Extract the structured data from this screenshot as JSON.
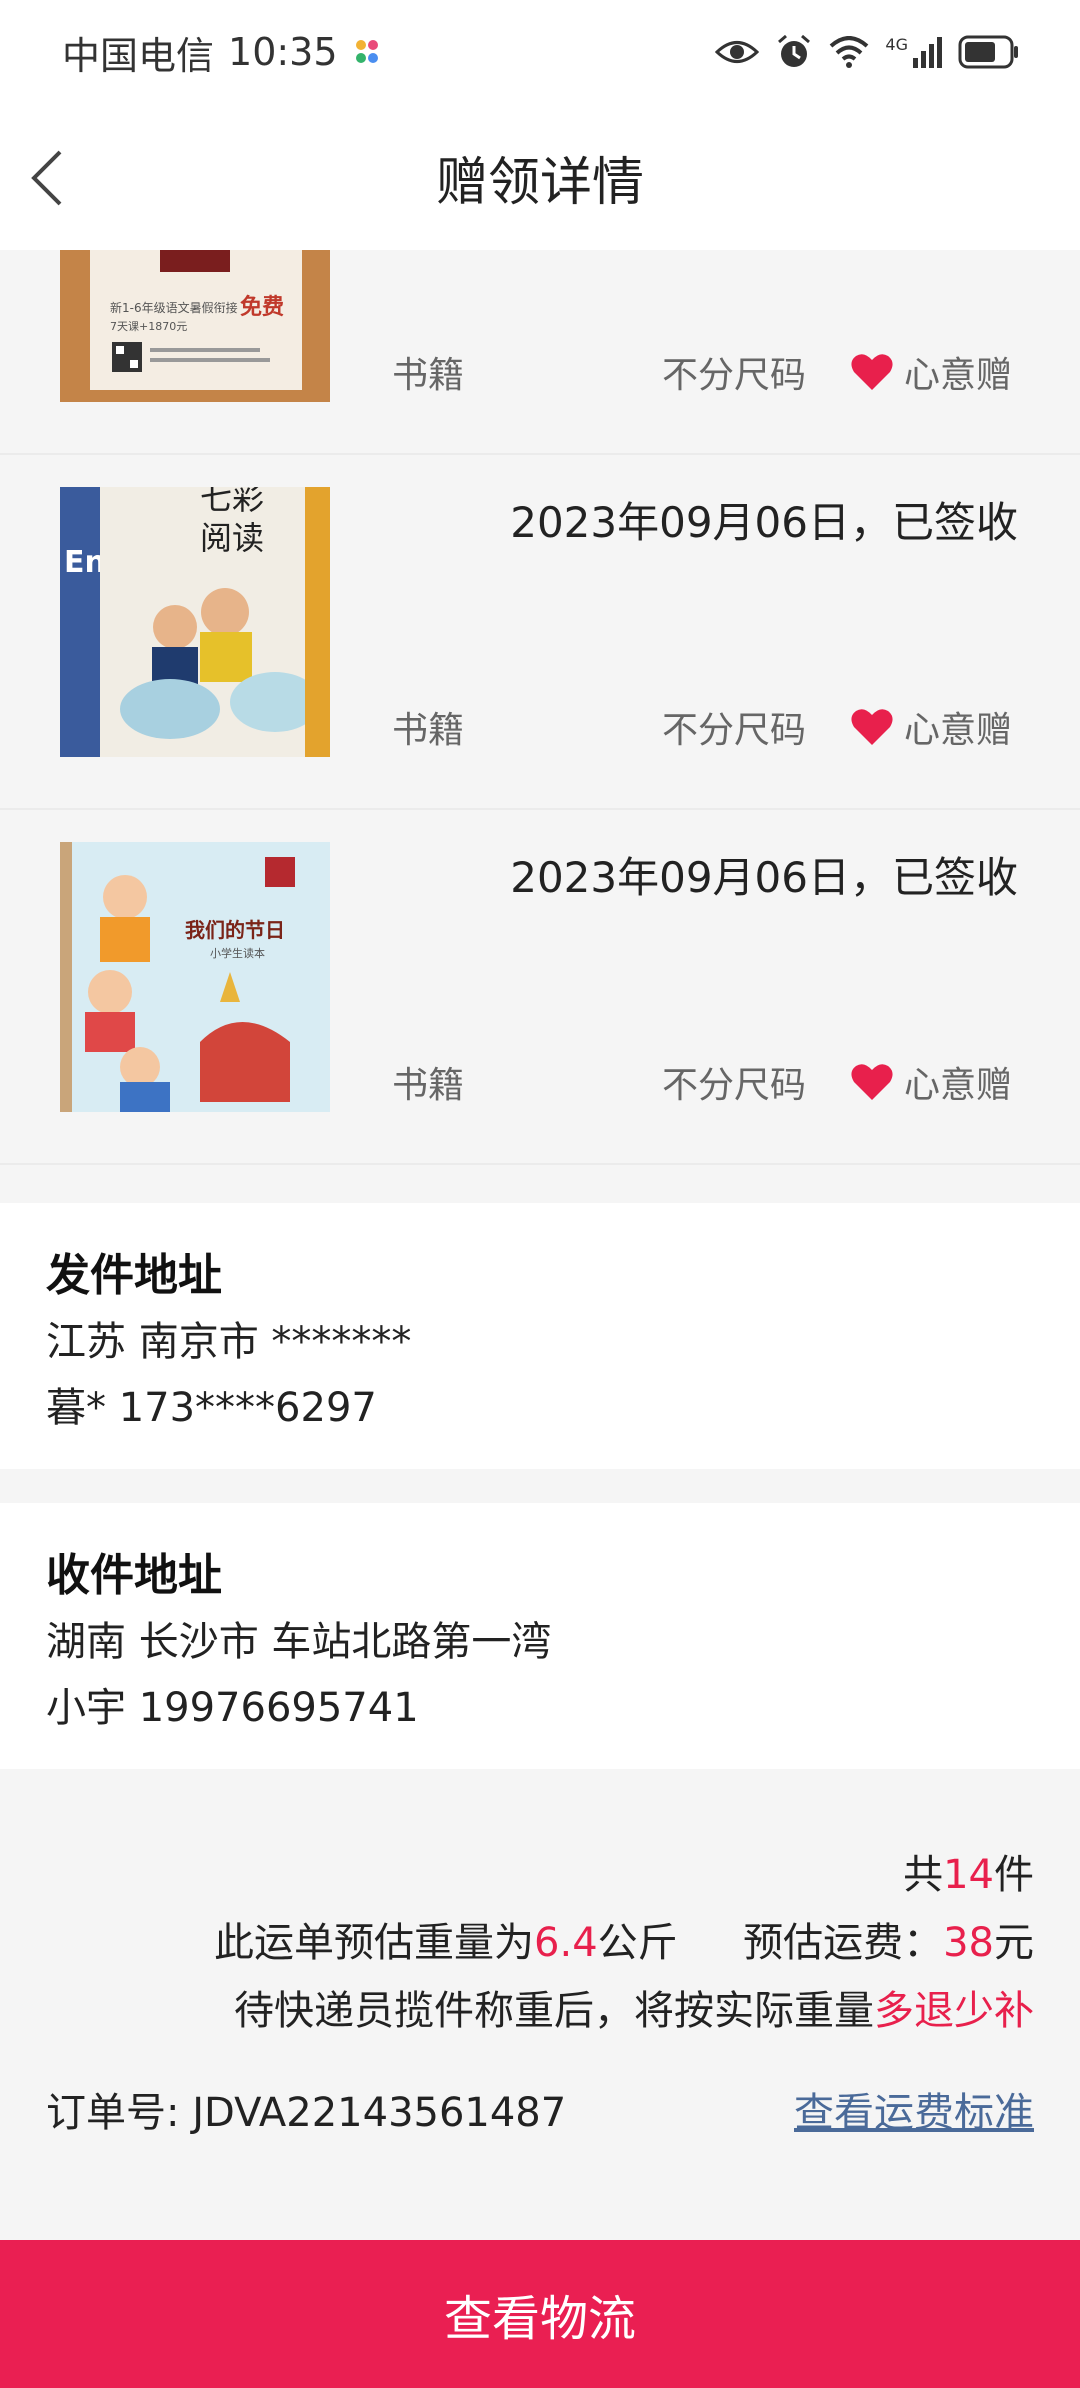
{
  "status_bar": {
    "carrier": "中国电信",
    "time": "10:35",
    "network": "4G"
  },
  "header": {
    "title": "赠领详情"
  },
  "items": [
    {
      "date": "",
      "category": "书籍",
      "size": "不分尺码",
      "gift_label": "心意赠",
      "cover_text": [
        "新1-6年级语文暑假衔接",
        "免费",
        "7天课+1870元"
      ]
    },
    {
      "date": "2023年09月06日，已签收",
      "category": "书籍",
      "size": "不分尺码",
      "gift_label": "心意赠",
      "cover_text": [
        "七彩",
        "阅读",
        "En"
      ]
    },
    {
      "date": "2023年09月06日，已签收",
      "category": "书籍",
      "size": "不分尺码",
      "gift_label": "心意赠",
      "cover_text": [
        "我们的节日",
        "小学生读本"
      ]
    }
  ],
  "sender": {
    "title": "发件地址",
    "address": "江苏 南京市 *******",
    "contact": "暮* 173****6297"
  },
  "receiver": {
    "title": "收件地址",
    "address": "湖南 长沙市 车站北路第一湾",
    "contact": "小宇 19976695741"
  },
  "summary": {
    "count_prefix": "共",
    "count": "14",
    "count_suffix": "件",
    "weight_prefix": "此运单预估重量为",
    "weight": "6.4",
    "weight_unit": "公斤",
    "fee_prefix": "预估运费：",
    "fee": "38",
    "fee_unit": "元",
    "note_prefix": "待快递员揽件称重后，将按实际重量",
    "note_highlight": "多退少补",
    "order_label": "订单号: ",
    "order_no": "JDVA22143561487",
    "fee_standard_link": "查看运费标准"
  },
  "bottom_button": {
    "label": "查看物流"
  },
  "colors": {
    "accent": "#ea1f52",
    "highlight": "#e8204c",
    "link": "#4a6a99"
  }
}
